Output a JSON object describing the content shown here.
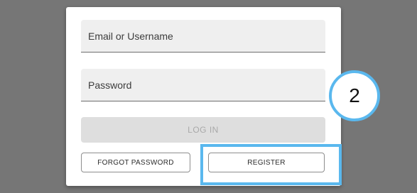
{
  "login_form": {
    "email_placeholder": "Email or Username",
    "password_placeholder": "Password",
    "login_label": "LOG IN",
    "forgot_password_label": "FORGOT PASSWORD",
    "register_label": "REGISTER"
  },
  "annotation": {
    "step_number": "2",
    "highlight_color": "#5ab8ee"
  }
}
